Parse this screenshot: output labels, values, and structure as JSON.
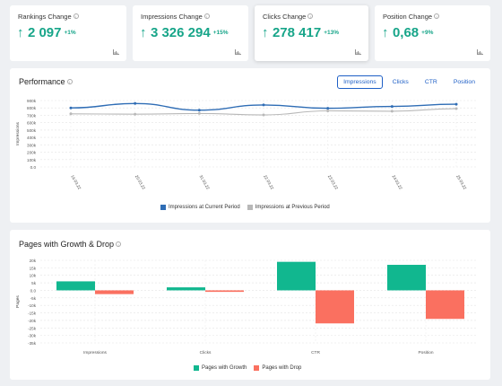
{
  "kpis": [
    {
      "title": "Rankings Change",
      "value": "2 097",
      "delta": "+1%"
    },
    {
      "title": "Impressions Change",
      "value": "3 326 294",
      "delta": "+15%"
    },
    {
      "title": "Clicks Change",
      "value": "278 417",
      "delta": "+13%"
    },
    {
      "title": "Position Change",
      "value": "0,68",
      "delta": "+9%"
    }
  ],
  "info_glyph": "i",
  "arrow_up": "↑",
  "performance": {
    "title": "Performance",
    "tabs": [
      "Impressions",
      "Clicks",
      "CTR",
      "Position"
    ],
    "active_tab": "Impressions",
    "ylabel": "Impressions",
    "legend": [
      "Impressions at Current Period",
      "Impressions at Previous Period"
    ]
  },
  "growth": {
    "title": "Pages with Growth & Drop",
    "ylabel": "Pages",
    "legend": [
      "Pages with Growth",
      "Pages with Drop"
    ]
  },
  "colors": {
    "accent": "#1e5fc6",
    "positive": "#17a589",
    "current_line": "#2f6db5",
    "previous_line": "#b8b8b8",
    "growth": "#11b78f",
    "drop": "#fa7060"
  },
  "chart_data": [
    {
      "type": "line",
      "x": [
        "16.03.22",
        "20.03.22",
        "31.03.22",
        "22.03.22",
        "23.03.22",
        "24.03.22",
        "25.03.22"
      ],
      "yticks": [
        "900k",
        "800k",
        "700k",
        "600k",
        "500k",
        "400k",
        "300k",
        "200k",
        "100k",
        "0.0"
      ],
      "ylim": [
        0,
        900000
      ],
      "ylabel": "Impressions",
      "series": [
        {
          "name": "Impressions at Current Period",
          "values": [
            800000,
            860000,
            770000,
            840000,
            795000,
            820000,
            850000
          ]
        },
        {
          "name": "Impressions at Previous Period",
          "values": [
            720000,
            715000,
            725000,
            705000,
            760000,
            755000,
            790000
          ]
        }
      ],
      "grid": true,
      "legend_position": "bottom"
    },
    {
      "type": "bar",
      "categories": [
        "Impressions",
        "Clicks",
        "CTR",
        "Position"
      ],
      "yticks": [
        "20k",
        "15k",
        "10k",
        "5k",
        "0.0",
        "-5k",
        "-10k",
        "-15k",
        "-20k",
        "-25k",
        "-30k",
        "-35k"
      ],
      "ylim": [
        -35000,
        20000
      ],
      "ylabel": "Pages",
      "series": [
        {
          "name": "Pages with Growth",
          "values": [
            6000,
            2000,
            19000,
            17000
          ]
        },
        {
          "name": "Pages with Drop",
          "values": [
            -2500,
            -1000,
            -22000,
            -19000
          ]
        }
      ],
      "grid": true,
      "legend_position": "bottom"
    }
  ]
}
